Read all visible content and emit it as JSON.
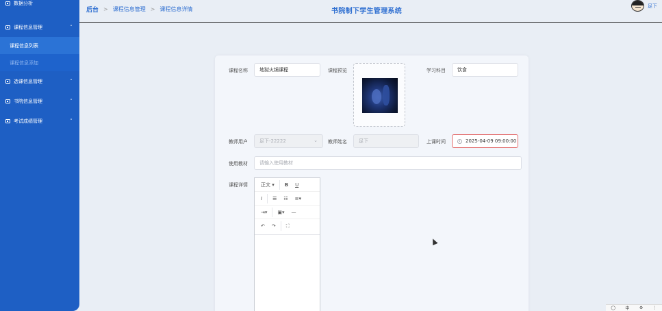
{
  "sidebar": {
    "items": [
      {
        "label": "数据分析"
      },
      {
        "label": "课程信息管理",
        "chevron": "˄"
      },
      {
        "label": "选课信息管理",
        "chevron": "˅"
      },
      {
        "label": "书院信息管理",
        "chevron": "˅"
      },
      {
        "label": "考试成绩管理",
        "chevron": "˅"
      }
    ],
    "submenu": [
      {
        "label": "课程信息列表"
      },
      {
        "label": "课程信息添加"
      }
    ]
  },
  "header": {
    "breadcrumbs": [
      "后台",
      "课程信息管理",
      "课程信息详情"
    ],
    "site_title": "书院制下学生管理系统",
    "user_name": "足下"
  },
  "form": {
    "course_name": {
      "label": "课程名称",
      "value": "地狱火锅课程"
    },
    "preview": {
      "label": "课程预览"
    },
    "subject": {
      "label": "学习科目",
      "value": "饮食"
    },
    "teacher_user": {
      "label": "教师用户",
      "value": "足下-22222"
    },
    "teacher_name": {
      "label": "教师姓名",
      "value": "足下"
    },
    "class_time": {
      "label": "上课时间",
      "value": "2025-04-09 09:00:00"
    },
    "textbook": {
      "label": "使用教材",
      "placeholder": "请输入使用教材"
    },
    "details": {
      "label": "课程详情"
    }
  },
  "editor": {
    "toolbar": {
      "paragraph": "正文",
      "bold": "B",
      "underline": "U",
      "italic": "I",
      "bullet_list": "☰",
      "numbered_list": "☷",
      "align": "≡",
      "indent": "⇥",
      "image": "▣",
      "divider": "—",
      "undo": "↶",
      "redo": "↷",
      "fullscreen": "⛶"
    }
  },
  "taskbar": {
    "items": [
      "◯",
      "中",
      "⚙",
      "⋮"
    ]
  }
}
